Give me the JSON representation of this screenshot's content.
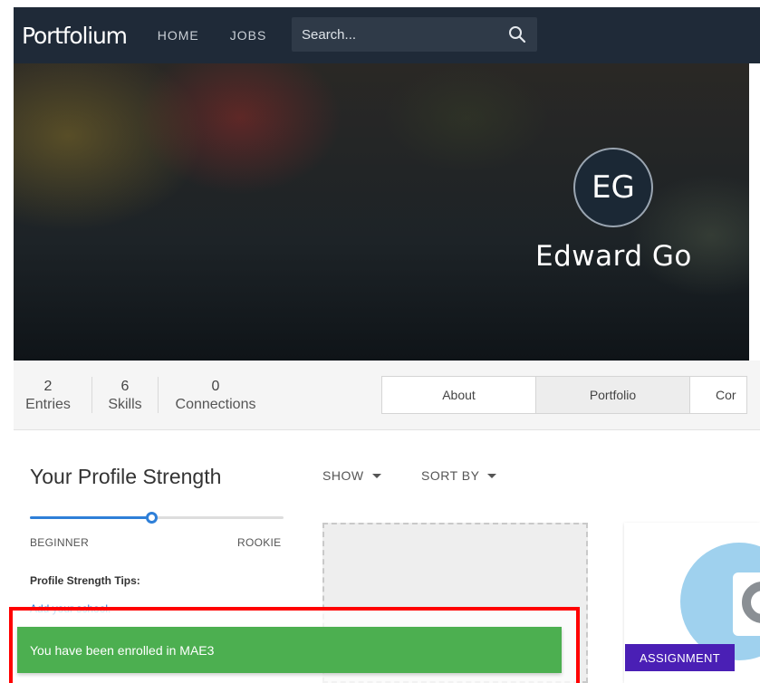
{
  "navbar": {
    "logo": "Portfolium",
    "links": [
      "HOME",
      "JOBS"
    ],
    "search": {
      "placeholder": "Search..."
    }
  },
  "profile": {
    "initials": "EG",
    "name": "Edward Go"
  },
  "stats": [
    {
      "value": "2",
      "label": "Entries"
    },
    {
      "value": "6",
      "label": "Skills"
    },
    {
      "value": "0",
      "label": "Connections"
    }
  ],
  "tabs": [
    {
      "label": "About",
      "active": false
    },
    {
      "label": "Portfolio",
      "active": true
    },
    {
      "label": "Cor",
      "active": false
    }
  ],
  "strength": {
    "title": "Your Profile Strength",
    "progress": 0.48,
    "level_left": "BEGINNER",
    "level_right": "ROOKIE",
    "tips_title": "Profile Strength Tips:",
    "tip": "Add your school."
  },
  "toolbar": {
    "show": "SHOW",
    "sort_by": "SORT BY"
  },
  "card": {
    "badge": "ASSIGNMENT"
  },
  "toast": {
    "message": "You have been enrolled in MAE3"
  },
  "colors": {
    "navbar": "#1f2a38",
    "accent": "#2e7fd8",
    "toast": "#4caf50",
    "badge": "#4a1fb5",
    "highlight": "#ff0000"
  }
}
